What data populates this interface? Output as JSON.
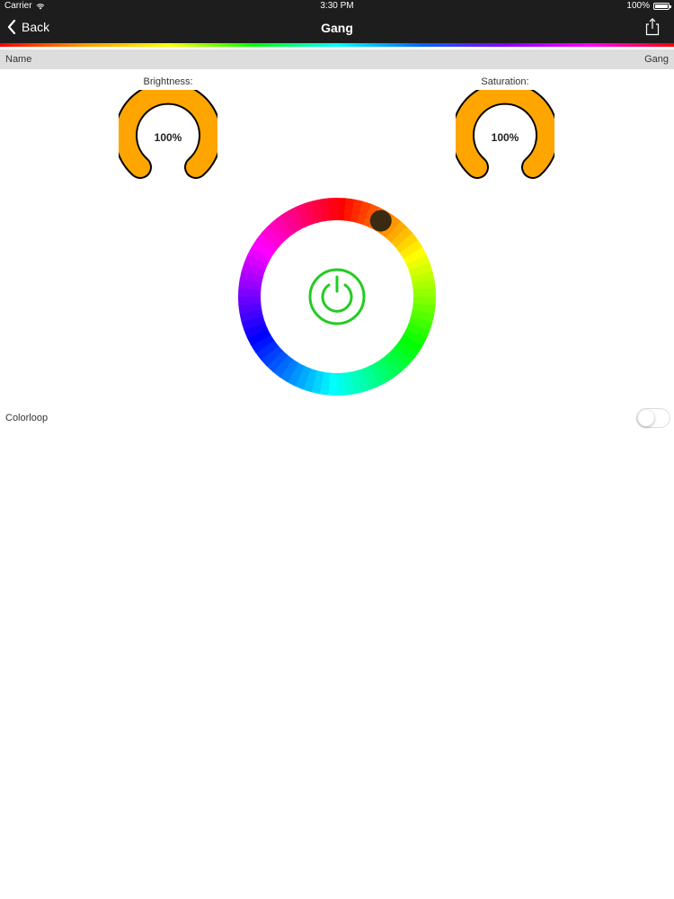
{
  "status_bar": {
    "carrier": "Carrier",
    "time": "3:30 PM",
    "battery": "100%",
    "wifi_icon": "wifi-icon",
    "battery_icon": "battery-icon"
  },
  "nav": {
    "back_label": "Back",
    "title": "Gang",
    "share_icon": "share-icon"
  },
  "name_row": {
    "label": "Name",
    "value": "Gang"
  },
  "brightness": {
    "label": "Brightness:",
    "value_text": "100%",
    "level": 1.0,
    "color": "#ffa500"
  },
  "saturation": {
    "label": "Saturation:",
    "value_text": "100%",
    "level": 1.0,
    "color": "#ffa500"
  },
  "color_wheel": {
    "selected_hue_degrees": 30,
    "power_color": "#22cc22"
  },
  "colorloop": {
    "label": "Colorloop",
    "enabled": false
  }
}
